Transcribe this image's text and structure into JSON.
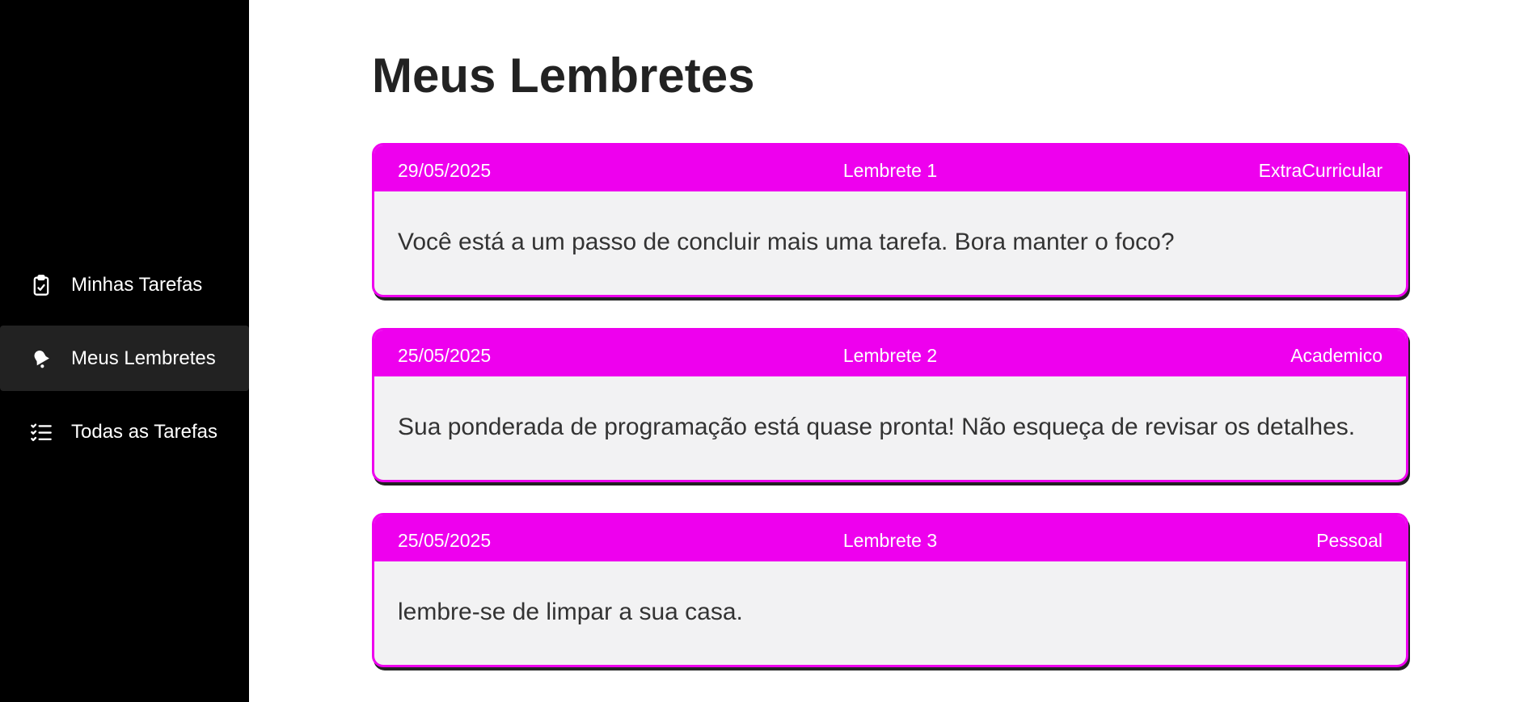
{
  "sidebar": {
    "items": [
      {
        "label": "Minhas Tarefas",
        "icon": "clipboard-check-icon",
        "active": false
      },
      {
        "label": "Meus Lembretes",
        "icon": "bell-icon",
        "active": true
      },
      {
        "label": "Todas as Tarefas",
        "icon": "list-check-icon",
        "active": false
      }
    ]
  },
  "main": {
    "title": "Meus Lembretes",
    "reminders": [
      {
        "date": "29/05/2025",
        "title": "Lembrete 1",
        "category": "ExtraCurricular",
        "text": "Você está a um passo de concluir mais uma tarefa. Bora manter o foco?"
      },
      {
        "date": "25/05/2025",
        "title": "Lembrete 2",
        "category": "Academico",
        "text": "Sua ponderada de programação está quase pronta! Não esqueça de revisar os detalhes."
      },
      {
        "date": "25/05/2025",
        "title": "Lembrete 3",
        "category": "Pessoal",
        "text": "lembre-se de limpar a sua casa."
      }
    ]
  },
  "colors": {
    "accent": "#ee00ee",
    "sidebar_bg": "#000000",
    "active_item_bg": "#222222",
    "card_bg": "#f2f2f3"
  }
}
